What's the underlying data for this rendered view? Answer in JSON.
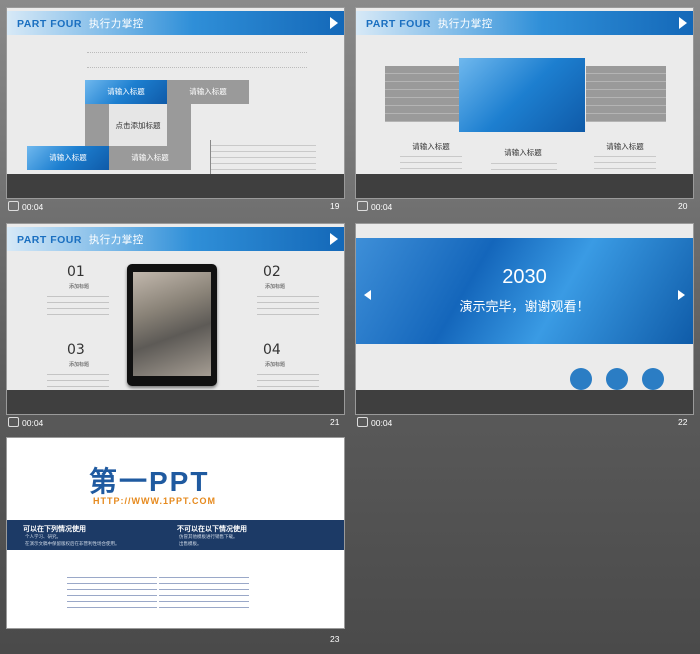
{
  "slides": [
    {
      "number": "19",
      "time": "00:04",
      "header": {
        "part": "PART FOUR",
        "subtitle": "执行力掌控"
      },
      "boxes": [
        "请输入标题",
        "请输入标题",
        "点击添加标题",
        "请输入标题",
        "请输入标题"
      ]
    },
    {
      "number": "20",
      "time": "00:04",
      "header": {
        "part": "PART FOUR",
        "subtitle": "执行力掌控"
      },
      "labels": [
        "请输入标题",
        "请输入标题",
        "请输入标题"
      ]
    },
    {
      "number": "21",
      "time": "00:04",
      "header": {
        "part": "PART FOUR",
        "subtitle": "执行力掌控"
      },
      "items": [
        {
          "num": "01",
          "title": "添加标题"
        },
        {
          "num": "02",
          "title": "添加标题"
        },
        {
          "num": "03",
          "title": "添加标题"
        },
        {
          "num": "04",
          "title": "添加标题"
        }
      ]
    },
    {
      "number": "22",
      "time": "00:04",
      "year": "2030",
      "message": "演示完毕，谢谢观看！"
    },
    {
      "number": "23",
      "logo": "第一PPT",
      "url": "HTTP://WWW.1PPT.COM",
      "left_heading": "可以在下列情况使用",
      "right_heading": "不可以在以下情况使用",
      "left_items": [
        "个人学习、研究。",
        "在演示文稿中保留版权后在非营利性场合使用。"
      ],
      "right_items": [
        "仿冒其他模板进行销售下载。",
        "出售模板。"
      ]
    }
  ]
}
